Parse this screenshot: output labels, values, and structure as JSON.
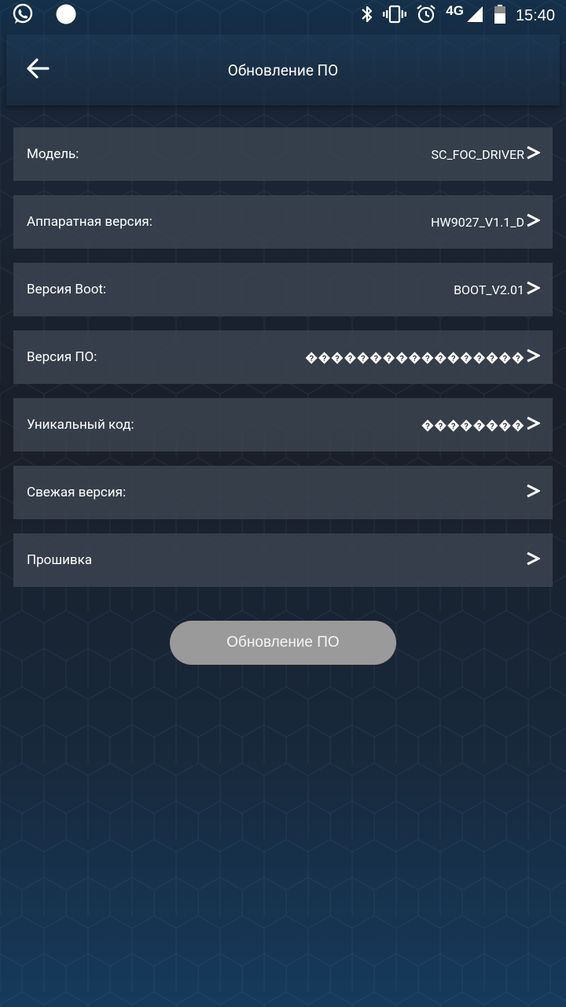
{
  "status_bar": {
    "time": "15:40",
    "network": "4G",
    "icons": [
      "whatsapp-icon",
      "notification-dot-icon",
      "bluetooth-icon",
      "vibrate-icon",
      "alarm-icon",
      "signal-icon",
      "battery-icon"
    ]
  },
  "header": {
    "title": "Обновление ПО",
    "back_icon": "arrow-left-icon"
  },
  "rows": [
    {
      "label": "Модель:",
      "value": "SC_FOC_DRIVER"
    },
    {
      "label": "Аппаратная версия:",
      "value": "HW9027_V1.1_D"
    },
    {
      "label": "Версия Boot:",
      "value": "BOOT_V2.01"
    },
    {
      "label": "Версия ПО:",
      "value": "�����������������"
    },
    {
      "label": "Уникальный код:",
      "value": "��������"
    },
    {
      "label": "Свежая версия:",
      "value": ""
    },
    {
      "label": "Прошивка",
      "value": ""
    }
  ],
  "update_button": {
    "label": "Обновление ПО"
  },
  "colors": {
    "button_bg": "#9a9a9a",
    "row_bg": "#3e4652",
    "text": "#ffffff"
  }
}
